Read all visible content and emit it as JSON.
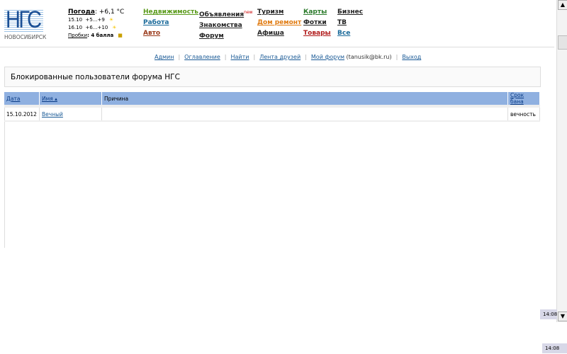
{
  "logo": {
    "letters": "НГС",
    "city": "НОВОСИБИРСК"
  },
  "weather": {
    "label": "Погода",
    "current": ": +6,1 °C",
    "days": [
      {
        "date": "15.10",
        "range": "+5...+9"
      },
      {
        "date": "16.10",
        "range": "+6...+10"
      }
    ],
    "traffic_label": "Пробки",
    "traffic_value": ": 4 балла"
  },
  "nav": [
    [
      {
        "label": "Недвижимость",
        "color": "#5a9a1a"
      },
      {
        "label": "Работа",
        "color": "#1a6a9a"
      },
      {
        "label": "Авто",
        "color": "#9a3a1a"
      }
    ],
    [
      {
        "label": "Объявления",
        "color": "#222",
        "badge": "new"
      },
      {
        "label": "Знакомства",
        "color": "#222"
      },
      {
        "label": "Форум",
        "color": "#222"
      }
    ],
    [
      {
        "label": "Туризм",
        "color": "#222"
      },
      {
        "label": "Дом ремонт",
        "color": "#e07a10"
      },
      {
        "label": "Афиша",
        "color": "#222"
      }
    ],
    [
      {
        "label": "Карты",
        "color": "#2a7a2a"
      },
      {
        "label": "Фотки",
        "color": "#222"
      },
      {
        "label": "Товары",
        "color": "#b01a1a"
      }
    ],
    [
      {
        "label": "Бизнес",
        "color": "#222"
      },
      {
        "label": "ТВ",
        "color": "#222"
      },
      {
        "label": "Все",
        "color": "#1a6a9a"
      }
    ]
  ],
  "links": {
    "admin": "Админ",
    "toc": "Оглавление",
    "find": "Найти",
    "friends": "Лента друзей",
    "myforum": "Мой форум",
    "user": " (tanusik@bk.ru)",
    "logout": "Выход"
  },
  "page_title": "Блокированные пользователи форума НГС",
  "table": {
    "headers": {
      "date": "Дата",
      "name": "Имя ▴",
      "reason": "Причина",
      "term": "Срок бана"
    },
    "rows": [
      {
        "date": "15.10.2012",
        "name": "Вечный",
        "reason": "",
        "term": "вечность"
      }
    ]
  },
  "clock": {
    "time1": "14:08",
    "time2": "14:08"
  }
}
